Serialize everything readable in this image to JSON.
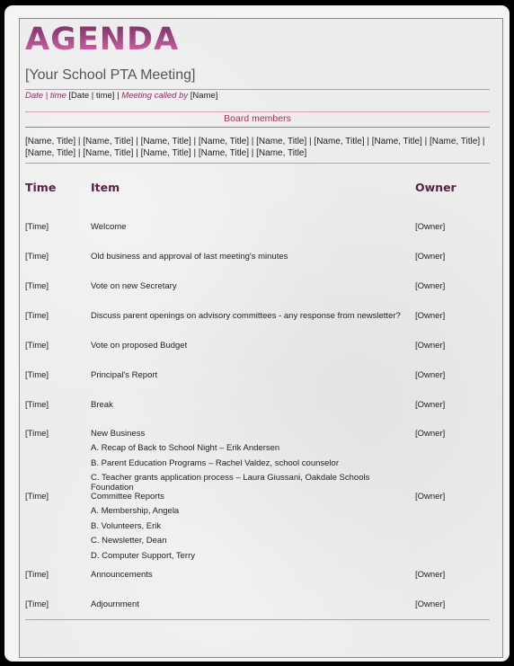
{
  "document": {
    "title": "AGENDA",
    "subtitle": "[Your School PTA Meeting]",
    "meta": {
      "date_label": "Date | time",
      "date_value": "[Date | time]",
      "separator": "|",
      "called_by_label": "Meeting called by",
      "called_by_value": "[Name]"
    },
    "board": {
      "label": "Board members",
      "members": [
        "[Name, Title]",
        "[Name, Title]",
        "[Name, Title]",
        "[Name, Title]",
        "[Name, Title]",
        "[Name, Title]",
        "[Name, Title]",
        "[Name, Title]",
        "[Name, Title]",
        "[Name, Title]",
        "[Name, Title]",
        "[Name, Title]",
        "[Name, Title]"
      ],
      "members_line1": "[Name, Title] | [Name, Title] | [Name, Title] | [Name, Title] | [Name, Title] | [Name, Title] | [Name, Title] | [Name, Title] |",
      "members_line2": "[Name, Title] | [Name, Title] | [Name, Title] | [Name, Title] | [Name, Title]"
    },
    "columns": {
      "time": "Time",
      "item": "Item",
      "owner": "Owner"
    },
    "rows": [
      {
        "time": "[Time]",
        "item": "Welcome",
        "owner": "[Owner]",
        "subitems": []
      },
      {
        "time": "[Time]",
        "item": "Old business and approval of last meeting's minutes",
        "owner": "[Owner]",
        "subitems": []
      },
      {
        "time": "[Time]",
        "item": "Vote on new Secretary",
        "owner": "[Owner]",
        "subitems": []
      },
      {
        "time": "[Time]",
        "item": "Discuss parent openings on advisory committees - any response from newsletter?",
        "owner": "[Owner]",
        "subitems": []
      },
      {
        "time": "[Time]",
        "item": "Vote on proposed Budget",
        "owner": "[Owner]",
        "subitems": []
      },
      {
        "time": "[Time]",
        "item": "Principal's Report",
        "owner": "[Owner]",
        "subitems": []
      },
      {
        "time": "[Time]",
        "item": "Break",
        "owner": "[Owner]",
        "subitems": []
      },
      {
        "time": "[Time]",
        "item": "New Business",
        "owner": "[Owner]",
        "subitems": [
          "A. Recap of Back to School Night – Erik Andersen",
          "B. Parent Education Programs – Rachel Valdez, school counselor",
          "C. Teacher grants application process – Laura Giussani, Oakdale Schools Foundation"
        ]
      },
      {
        "time": "[Time]",
        "item": "Committee Reports",
        "owner": "[Owner]",
        "subitems": [
          "A. Membership, Angela",
          "B. Volunteers, Erik",
          "C. Newsletter, Dean",
          "D. Computer Support, Terry"
        ]
      },
      {
        "time": "[Time]",
        "item": "Announcements",
        "owner": "[Owner]",
        "subitems": []
      },
      {
        "time": "[Time]",
        "item": "Adjournment",
        "owner": "[Owner]",
        "subitems": []
      }
    ]
  }
}
